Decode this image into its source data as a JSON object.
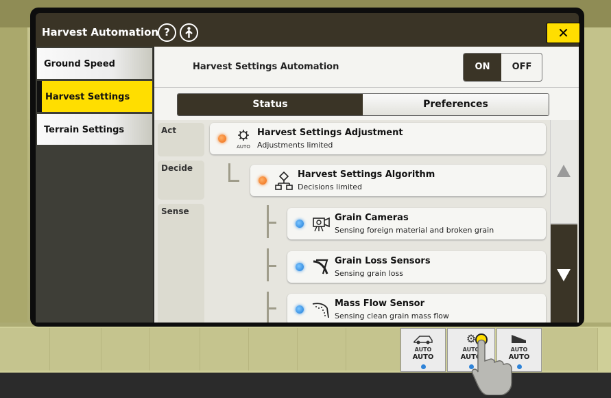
{
  "dialog": {
    "title": "Harvest Automation",
    "help_icon": "question-circle-icon",
    "info_icon": "info-circle-icon",
    "close_label": "✕"
  },
  "sidebar": {
    "items": [
      {
        "label": "Ground Speed",
        "selected": false
      },
      {
        "label": "Harvest Settings",
        "selected": true
      },
      {
        "label": "Terrain Settings",
        "selected": false
      }
    ]
  },
  "main": {
    "automation_label": "Harvest Settings Automation",
    "toggle": {
      "on": "ON",
      "off": "OFF",
      "value": "ON"
    },
    "tabs": [
      {
        "label": "Status",
        "active": true
      },
      {
        "label": "Preferences",
        "active": false
      }
    ],
    "lanes": [
      {
        "label": "Act"
      },
      {
        "label": "Decide"
      },
      {
        "label": "Sense"
      }
    ],
    "cards": [
      {
        "title": "Harvest Settings Adjustment",
        "subtitle": "Adjustments limited",
        "status": "orange",
        "icon": "gear-auto-icon",
        "icon_text": "AUTO"
      },
      {
        "title": "Harvest Settings Algorithm",
        "subtitle": "Decisions limited",
        "status": "orange",
        "icon": "decision-tree-icon"
      },
      {
        "title": "Grain Cameras",
        "subtitle": "Sensing foreign material and broken grain",
        "status": "blue",
        "icon": "camera-icon"
      },
      {
        "title": "Grain Loss Sensors",
        "subtitle": "Sensing grain loss",
        "status": "blue",
        "icon": "grain-loss-icon"
      },
      {
        "title": "Mass Flow Sensor",
        "subtitle": "Sensing clean grain mass flow",
        "status": "blue",
        "icon": "mass-flow-icon"
      }
    ]
  },
  "bottom_bar": {
    "auto_buttons": [
      {
        "small": "AUTO",
        "big": "AUTO",
        "icon": "harvester-auto-icon"
      },
      {
        "small": "AUTO",
        "big": "AUTO",
        "icon": "gear-auto-icon"
      },
      {
        "small": "AUTO",
        "big": "AUTO",
        "icon": "header-auto-icon"
      }
    ]
  },
  "colors": {
    "accent_yellow": "#ffde00",
    "header_brown": "#3a3426",
    "status_orange": "#ee6a12",
    "status_blue": "#1f7bd8"
  }
}
